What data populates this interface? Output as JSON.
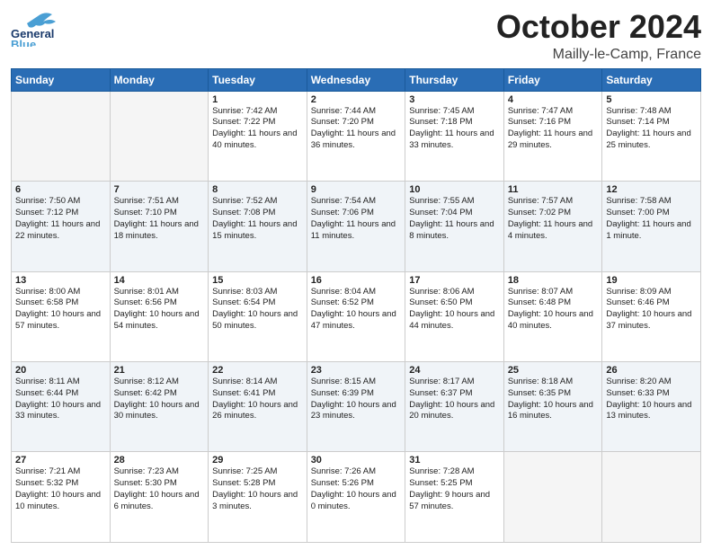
{
  "header": {
    "logo_general": "General",
    "logo_blue": "Blue",
    "title": "October 2024",
    "subtitle": "Mailly-le-Camp, France"
  },
  "days_of_week": [
    "Sunday",
    "Monday",
    "Tuesday",
    "Wednesday",
    "Thursday",
    "Friday",
    "Saturday"
  ],
  "weeks": [
    [
      {
        "day": "",
        "empty": true
      },
      {
        "day": "",
        "empty": true
      },
      {
        "day": "1",
        "sunrise": "Sunrise: 7:42 AM",
        "sunset": "Sunset: 7:22 PM",
        "daylight": "Daylight: 11 hours and 40 minutes."
      },
      {
        "day": "2",
        "sunrise": "Sunrise: 7:44 AM",
        "sunset": "Sunset: 7:20 PM",
        "daylight": "Daylight: 11 hours and 36 minutes."
      },
      {
        "day": "3",
        "sunrise": "Sunrise: 7:45 AM",
        "sunset": "Sunset: 7:18 PM",
        "daylight": "Daylight: 11 hours and 33 minutes."
      },
      {
        "day": "4",
        "sunrise": "Sunrise: 7:47 AM",
        "sunset": "Sunset: 7:16 PM",
        "daylight": "Daylight: 11 hours and 29 minutes."
      },
      {
        "day": "5",
        "sunrise": "Sunrise: 7:48 AM",
        "sunset": "Sunset: 7:14 PM",
        "daylight": "Daylight: 11 hours and 25 minutes."
      }
    ],
    [
      {
        "day": "6",
        "sunrise": "Sunrise: 7:50 AM",
        "sunset": "Sunset: 7:12 PM",
        "daylight": "Daylight: 11 hours and 22 minutes."
      },
      {
        "day": "7",
        "sunrise": "Sunrise: 7:51 AM",
        "sunset": "Sunset: 7:10 PM",
        "daylight": "Daylight: 11 hours and 18 minutes."
      },
      {
        "day": "8",
        "sunrise": "Sunrise: 7:52 AM",
        "sunset": "Sunset: 7:08 PM",
        "daylight": "Daylight: 11 hours and 15 minutes."
      },
      {
        "day": "9",
        "sunrise": "Sunrise: 7:54 AM",
        "sunset": "Sunset: 7:06 PM",
        "daylight": "Daylight: 11 hours and 11 minutes."
      },
      {
        "day": "10",
        "sunrise": "Sunrise: 7:55 AM",
        "sunset": "Sunset: 7:04 PM",
        "daylight": "Daylight: 11 hours and 8 minutes."
      },
      {
        "day": "11",
        "sunrise": "Sunrise: 7:57 AM",
        "sunset": "Sunset: 7:02 PM",
        "daylight": "Daylight: 11 hours and 4 minutes."
      },
      {
        "day": "12",
        "sunrise": "Sunrise: 7:58 AM",
        "sunset": "Sunset: 7:00 PM",
        "daylight": "Daylight: 11 hours and 1 minute."
      }
    ],
    [
      {
        "day": "13",
        "sunrise": "Sunrise: 8:00 AM",
        "sunset": "Sunset: 6:58 PM",
        "daylight": "Daylight: 10 hours and 57 minutes."
      },
      {
        "day": "14",
        "sunrise": "Sunrise: 8:01 AM",
        "sunset": "Sunset: 6:56 PM",
        "daylight": "Daylight: 10 hours and 54 minutes."
      },
      {
        "day": "15",
        "sunrise": "Sunrise: 8:03 AM",
        "sunset": "Sunset: 6:54 PM",
        "daylight": "Daylight: 10 hours and 50 minutes."
      },
      {
        "day": "16",
        "sunrise": "Sunrise: 8:04 AM",
        "sunset": "Sunset: 6:52 PM",
        "daylight": "Daylight: 10 hours and 47 minutes."
      },
      {
        "day": "17",
        "sunrise": "Sunrise: 8:06 AM",
        "sunset": "Sunset: 6:50 PM",
        "daylight": "Daylight: 10 hours and 44 minutes."
      },
      {
        "day": "18",
        "sunrise": "Sunrise: 8:07 AM",
        "sunset": "Sunset: 6:48 PM",
        "daylight": "Daylight: 10 hours and 40 minutes."
      },
      {
        "day": "19",
        "sunrise": "Sunrise: 8:09 AM",
        "sunset": "Sunset: 6:46 PM",
        "daylight": "Daylight: 10 hours and 37 minutes."
      }
    ],
    [
      {
        "day": "20",
        "sunrise": "Sunrise: 8:11 AM",
        "sunset": "Sunset: 6:44 PM",
        "daylight": "Daylight: 10 hours and 33 minutes."
      },
      {
        "day": "21",
        "sunrise": "Sunrise: 8:12 AM",
        "sunset": "Sunset: 6:42 PM",
        "daylight": "Daylight: 10 hours and 30 minutes."
      },
      {
        "day": "22",
        "sunrise": "Sunrise: 8:14 AM",
        "sunset": "Sunset: 6:41 PM",
        "daylight": "Daylight: 10 hours and 26 minutes."
      },
      {
        "day": "23",
        "sunrise": "Sunrise: 8:15 AM",
        "sunset": "Sunset: 6:39 PM",
        "daylight": "Daylight: 10 hours and 23 minutes."
      },
      {
        "day": "24",
        "sunrise": "Sunrise: 8:17 AM",
        "sunset": "Sunset: 6:37 PM",
        "daylight": "Daylight: 10 hours and 20 minutes."
      },
      {
        "day": "25",
        "sunrise": "Sunrise: 8:18 AM",
        "sunset": "Sunset: 6:35 PM",
        "daylight": "Daylight: 10 hours and 16 minutes."
      },
      {
        "day": "26",
        "sunrise": "Sunrise: 8:20 AM",
        "sunset": "Sunset: 6:33 PM",
        "daylight": "Daylight: 10 hours and 13 minutes."
      }
    ],
    [
      {
        "day": "27",
        "sunrise": "Sunrise: 7:21 AM",
        "sunset": "Sunset: 5:32 PM",
        "daylight": "Daylight: 10 hours and 10 minutes."
      },
      {
        "day": "28",
        "sunrise": "Sunrise: 7:23 AM",
        "sunset": "Sunset: 5:30 PM",
        "daylight": "Daylight: 10 hours and 6 minutes."
      },
      {
        "day": "29",
        "sunrise": "Sunrise: 7:25 AM",
        "sunset": "Sunset: 5:28 PM",
        "daylight": "Daylight: 10 hours and 3 minutes."
      },
      {
        "day": "30",
        "sunrise": "Sunrise: 7:26 AM",
        "sunset": "Sunset: 5:26 PM",
        "daylight": "Daylight: 10 hours and 0 minutes."
      },
      {
        "day": "31",
        "sunrise": "Sunrise: 7:28 AM",
        "sunset": "Sunset: 5:25 PM",
        "daylight": "Daylight: 9 hours and 57 minutes."
      },
      {
        "day": "",
        "empty": true
      },
      {
        "day": "",
        "empty": true
      }
    ]
  ]
}
